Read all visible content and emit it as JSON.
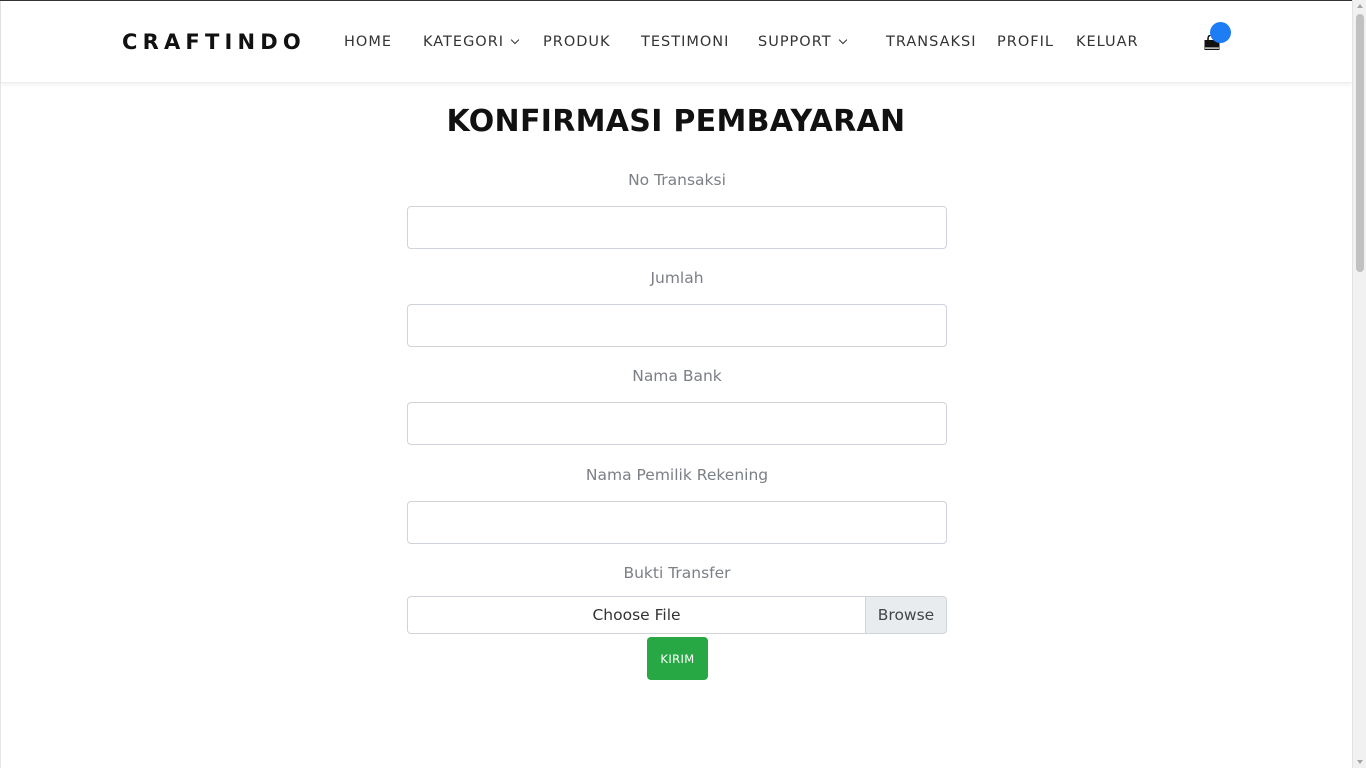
{
  "header": {
    "logo": "CRAFTINDO",
    "nav": [
      {
        "label": "HOME",
        "has_dropdown": false
      },
      {
        "label": "KATEGORI",
        "has_dropdown": true
      },
      {
        "label": "PRODUK",
        "has_dropdown": false
      },
      {
        "label": "TESTIMONI",
        "has_dropdown": false
      },
      {
        "label": "SUPPORT",
        "has_dropdown": true
      },
      {
        "label": "TRANSAKSI",
        "has_dropdown": false
      },
      {
        "label": "PROFIL",
        "has_dropdown": false
      },
      {
        "label": "KELUAR",
        "has_dropdown": false
      }
    ],
    "cart_icon": "shopping-bag-icon",
    "badge_color": "#1e7df5"
  },
  "main": {
    "title": "KONFIRMASI PEMBAYARAN",
    "fields": [
      {
        "label": "No Transaksi",
        "value": ""
      },
      {
        "label": "Jumlah",
        "value": ""
      },
      {
        "label": "Nama Bank",
        "value": ""
      },
      {
        "label": "Nama Pemilik Rekening",
        "value": ""
      }
    ],
    "file_field": {
      "label": "Bukti Transfer",
      "placeholder": "Choose File",
      "browse_label": "Browse"
    },
    "submit_label": "KIRIM",
    "submit_color": "#28a745"
  }
}
